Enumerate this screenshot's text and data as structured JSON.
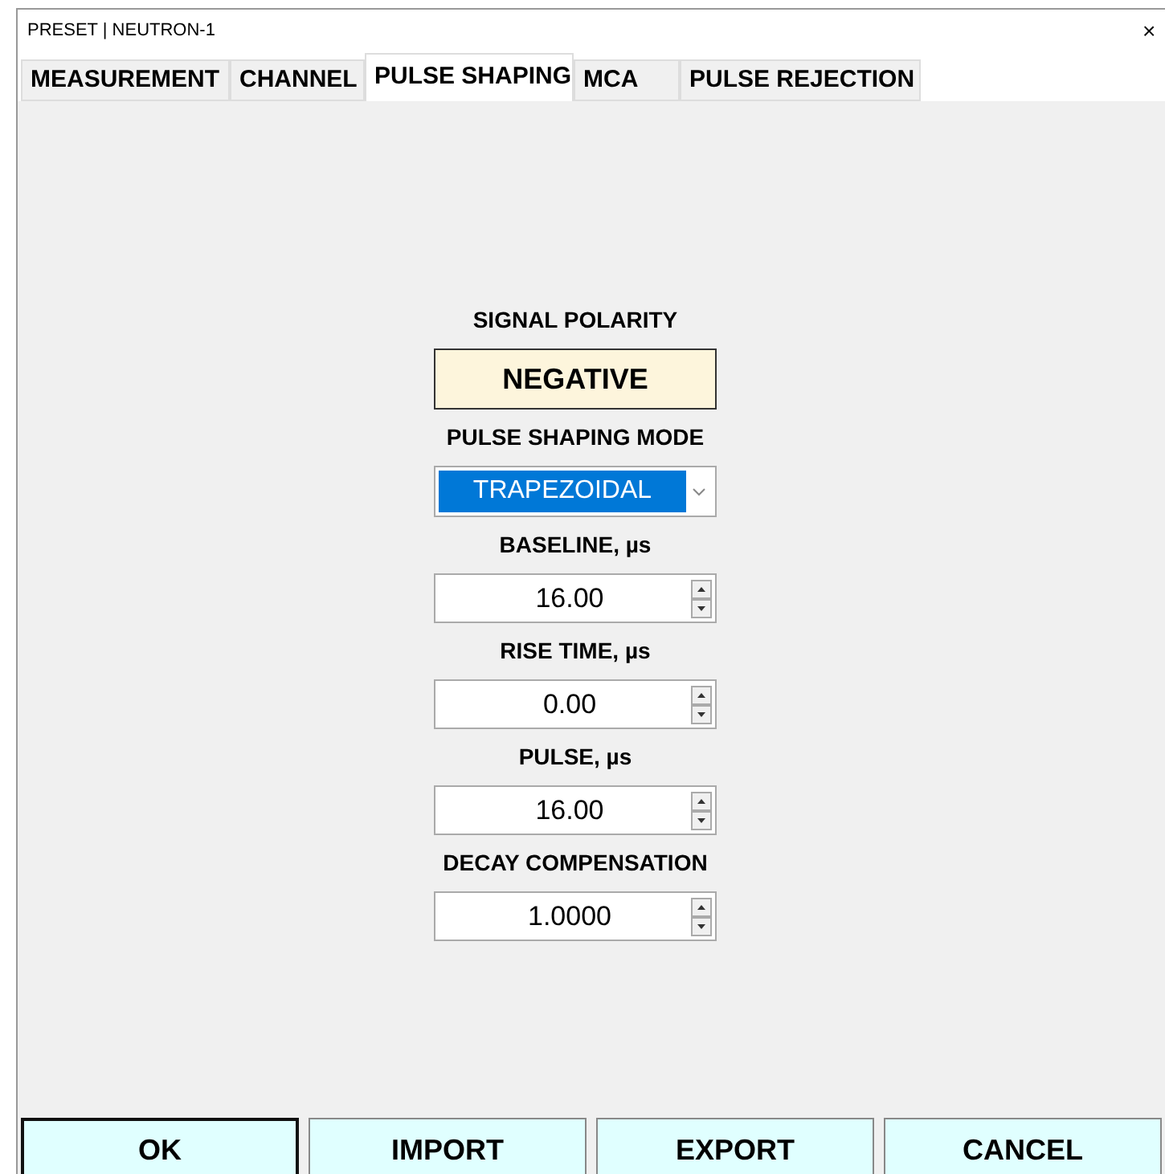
{
  "window": {
    "title": "PRESET | NEUTRON-1",
    "close": "×"
  },
  "tabs": [
    {
      "label": "MEASUREMENT",
      "selected": false
    },
    {
      "label": "CHANNEL",
      "selected": false
    },
    {
      "label": "PULSE SHAPING",
      "selected": true
    },
    {
      "label": "MCA",
      "selected": false
    },
    {
      "label": "PULSE REJECTION",
      "selected": false
    }
  ],
  "fields": [
    {
      "kind": "toggle",
      "label": "SIGNAL POLARITY",
      "value": "NEGATIVE"
    },
    {
      "kind": "dropdown",
      "label": "PULSE SHAPING MODE",
      "value": "TRAPEZOIDAL"
    },
    {
      "kind": "spinner",
      "label": "BASELINE, µs",
      "value": "16.00"
    },
    {
      "kind": "spinner",
      "label": "RISE TIME, µs",
      "value": "0.00"
    },
    {
      "kind": "spinner",
      "label": "PULSE, µs",
      "value": "16.00"
    },
    {
      "kind": "spinner",
      "label": "DECAY COMPENSATION",
      "value": "1.0000"
    }
  ],
  "buttons": [
    {
      "label": "OK",
      "default": true
    },
    {
      "label": "IMPORT",
      "default": false
    },
    {
      "label": "EXPORT",
      "default": false
    },
    {
      "label": "CANCEL",
      "default": false
    }
  ]
}
